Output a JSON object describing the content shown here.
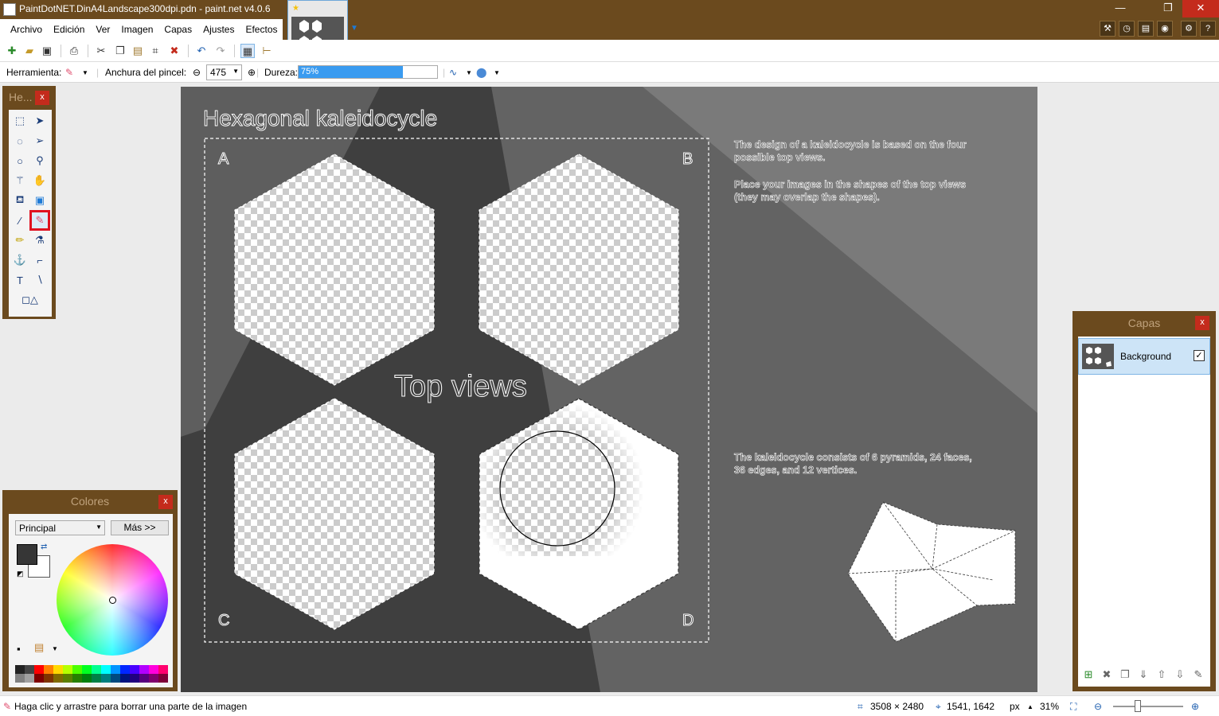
{
  "window": {
    "title": "PaintDotNET.DinA4Landscape300dpi.pdn - paint.net v4.0.6",
    "minimize": "—",
    "maximize": "❐",
    "close": "✕"
  },
  "menu": {
    "items": [
      "Archivo",
      "Edición",
      "Ver",
      "Imagen",
      "Capas",
      "Ajustes",
      "Efectos"
    ]
  },
  "options": {
    "tool_label": "Herramienta:",
    "brush_width_label": "Anchura del pincel:",
    "brush_width_value": "475",
    "hardness_label": "Dureza:",
    "hardness_value": "75%",
    "hardness_fraction": 0.75
  },
  "canvas": {
    "title": "Hexagonal kaleidocycle",
    "corner_a": "A",
    "corner_b": "B",
    "corner_c": "C",
    "corner_d": "D",
    "center_label": "Top views",
    "text1_line1": "The design of a kaleidocycle is based on the four",
    "text1_line2": "possible top views.",
    "text2_line1": "Place your images in the shapes of the top views",
    "text2_line2": "(they may overlap the shapes).",
    "text3_line1": "The kaleidocycle consists of 6 pyramids, 24 faces,",
    "text3_line2": "36 edges, and 12 vertices."
  },
  "tools_window": {
    "title": "He...",
    "close": "x"
  },
  "colors_window": {
    "title": "Colores",
    "close": "x",
    "palette_mode": "Principal",
    "more_button": "Más >>",
    "primary_color": "#363636",
    "secondary_color": "#ffffff"
  },
  "layers_window": {
    "title": "Capas",
    "close": "x",
    "layer_name": "Background",
    "layer_visible": "✓"
  },
  "status": {
    "hint": "Haga clic y arrastre para borrar una parte de la imagen",
    "image_size": "3508 × 2480",
    "cursor_pos": "1541, 1642",
    "units": "px",
    "zoom": "31%"
  },
  "palette_colors": [
    "#222222",
    "#444444",
    "#ff0000",
    "#ff7f00",
    "#ffd800",
    "#b6ff00",
    "#4cff00",
    "#00ff21",
    "#00ff90",
    "#00ffff",
    "#0094ff",
    "#0026ff",
    "#4800ff",
    "#b200ff",
    "#ff00dc",
    "#ff006e",
    "#808080",
    "#a0a0a0",
    "#7f0000",
    "#7f3300",
    "#7f6a00",
    "#5b7f00",
    "#267f00",
    "#007f0e",
    "#007f46",
    "#007f7f",
    "#004a7f",
    "#00137f",
    "#21007f",
    "#57007f",
    "#7f006e",
    "#7f0037"
  ]
}
